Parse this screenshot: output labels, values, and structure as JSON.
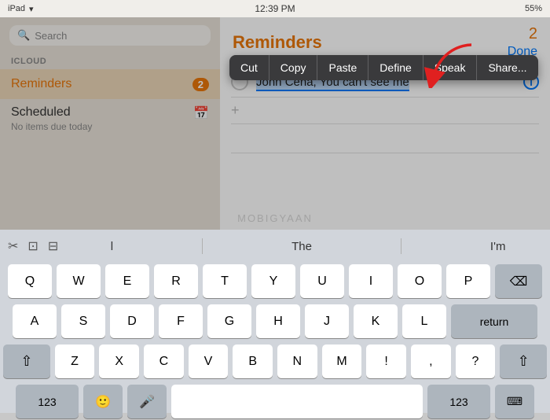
{
  "statusBar": {
    "left": "iPad",
    "time": "12:39 PM",
    "battery": "55%",
    "wifi": "▲"
  },
  "sidebar": {
    "searchPlaceholder": "Search",
    "sectionHeader": "ICLOUD",
    "items": [
      {
        "label": "Reminders",
        "badge": "2",
        "active": true
      },
      {
        "label": "Scheduled",
        "sub": "No items due today",
        "icon": "📅"
      }
    ]
  },
  "reminder": {
    "title": "Reminders",
    "count": "2",
    "doneLabel": "Done",
    "item": {
      "text": "John Cena, You can't see me",
      "selected": "John Cena, You can't see me"
    },
    "addIcon": "+"
  },
  "contextMenu": {
    "items": [
      "Cut",
      "Copy",
      "Paste",
      "Define",
      "Speak",
      "Share..."
    ]
  },
  "autocomplete": {
    "tools": [
      "✂",
      "⊡",
      "⊟"
    ],
    "suggestions": [
      "l",
      "The",
      "I'm"
    ]
  },
  "keyboard": {
    "rows": [
      [
        "Q",
        "W",
        "E",
        "R",
        "T",
        "Y",
        "U",
        "I",
        "O",
        "P"
      ],
      [
        "A",
        "S",
        "D",
        "F",
        "G",
        "H",
        "J",
        "K",
        "L"
      ],
      [
        "Z",
        "X",
        "C",
        "V",
        "B",
        "N",
        "M",
        "!",
        ",",
        "?"
      ]
    ],
    "bottomRow": {
      "num": "123",
      "emoji": "🙂",
      "mic": "🎤",
      "space": " ",
      "numRight": "123",
      "kbd": "⌨"
    },
    "return": "return",
    "shift": "⇧",
    "backspace": "⌫"
  },
  "watermark": "MOBIGYAAN"
}
